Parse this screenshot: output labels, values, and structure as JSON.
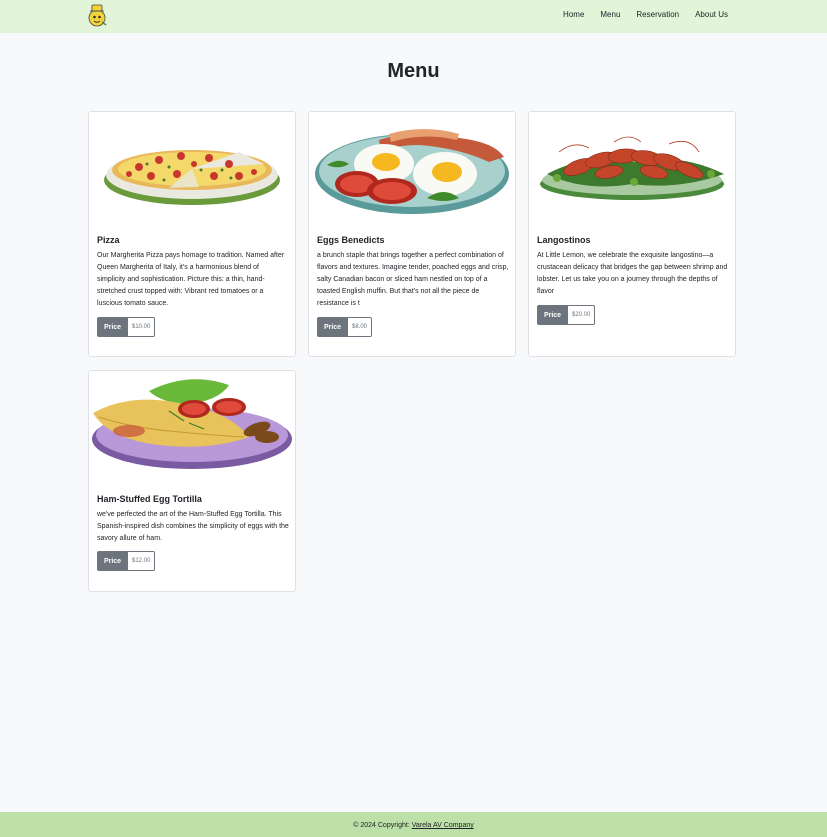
{
  "nav": {
    "links": [
      "Home",
      "Menu",
      "Reservation",
      "About Us"
    ]
  },
  "main": {
    "title": "Menu",
    "price_label": "Price",
    "items": [
      {
        "name": "Pizza",
        "description": "Our Margherita Pizza pays homage to tradition. Named after Queen Margherita of Italy, it's a harmonious blend of simplicity and sophistication. Picture this: a thin, hand-stretched crust topped with: Vibrant red tomatoes or a luscious tomato sauce.",
        "price": "$10.00"
      },
      {
        "name": "Eggs Benedicts",
        "description": "a brunch staple that brings together a perfect combination of flavors and textures. Imagine tender, poached eggs and crisp, salty Canadian bacon or sliced ham nestled on top of a toasted English muffin. But that's not all the piece de resistance is t",
        "price": "$8.00"
      },
      {
        "name": "Langostinos",
        "description": "At Little Lemon, we celebrate the exquisite langostino—a crustacean delicacy that bridges the gap between shrimp and lobster. Let us take you on a journey through the depths of flavor",
        "price": "$20.00"
      },
      {
        "name": "Ham-Stuffed Egg Tortilla",
        "description": "we've perfected the art of the Ham-Stuffed Egg Tortilla. This Spanish-inspired dish combines the simplicity of eggs with the savory allure of ham.",
        "price": "$12.00"
      }
    ]
  },
  "footer": {
    "copyright": "© 2024 Copyright:",
    "company": "Varela AV Company"
  },
  "colors": {
    "navbar_bg": "#e2f5d9",
    "footer_bg": "#bde0a8",
    "price_button": "#6c757d"
  }
}
